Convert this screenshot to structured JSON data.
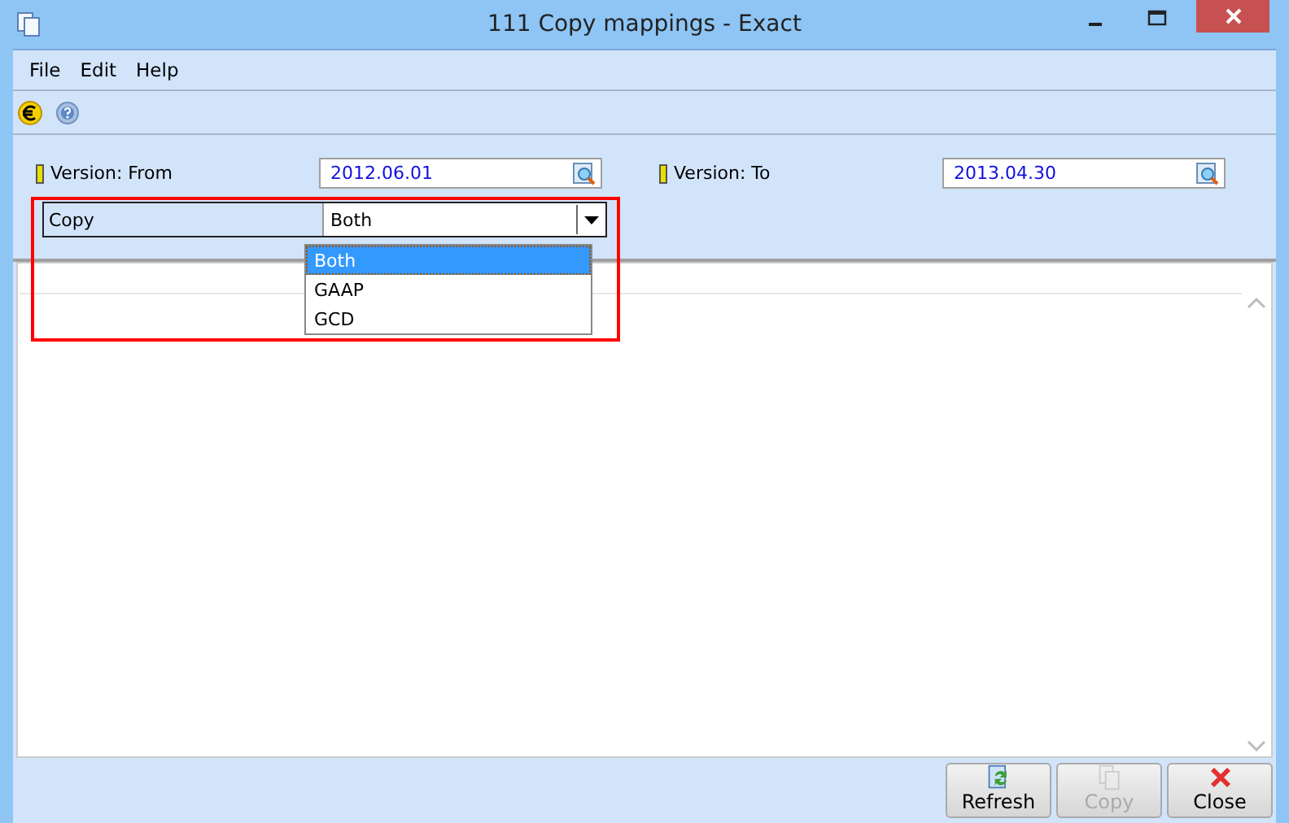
{
  "window": {
    "title": "111 Copy mappings - Exact"
  },
  "menu": [
    {
      "label": "File"
    },
    {
      "label": "Edit"
    },
    {
      "label": "Help"
    }
  ],
  "filters": [
    {
      "label": "Version: From",
      "value": "2012.06.01"
    },
    {
      "label": "Version: To",
      "value": "2013.04.30"
    }
  ],
  "copy": {
    "label": "Copy",
    "value": "Both",
    "expanded": true,
    "options": [
      {
        "label": "Both",
        "selected": true
      },
      {
        "label": "GAAP",
        "selected": false
      },
      {
        "label": "GCD",
        "selected": false
      }
    ]
  },
  "buttons": [
    {
      "kind": "refresh",
      "label": "Refresh",
      "disabled": false
    },
    {
      "kind": "copy",
      "label": "Copy",
      "disabled": true
    },
    {
      "kind": "close",
      "label": "Close",
      "disabled": false
    }
  ]
}
